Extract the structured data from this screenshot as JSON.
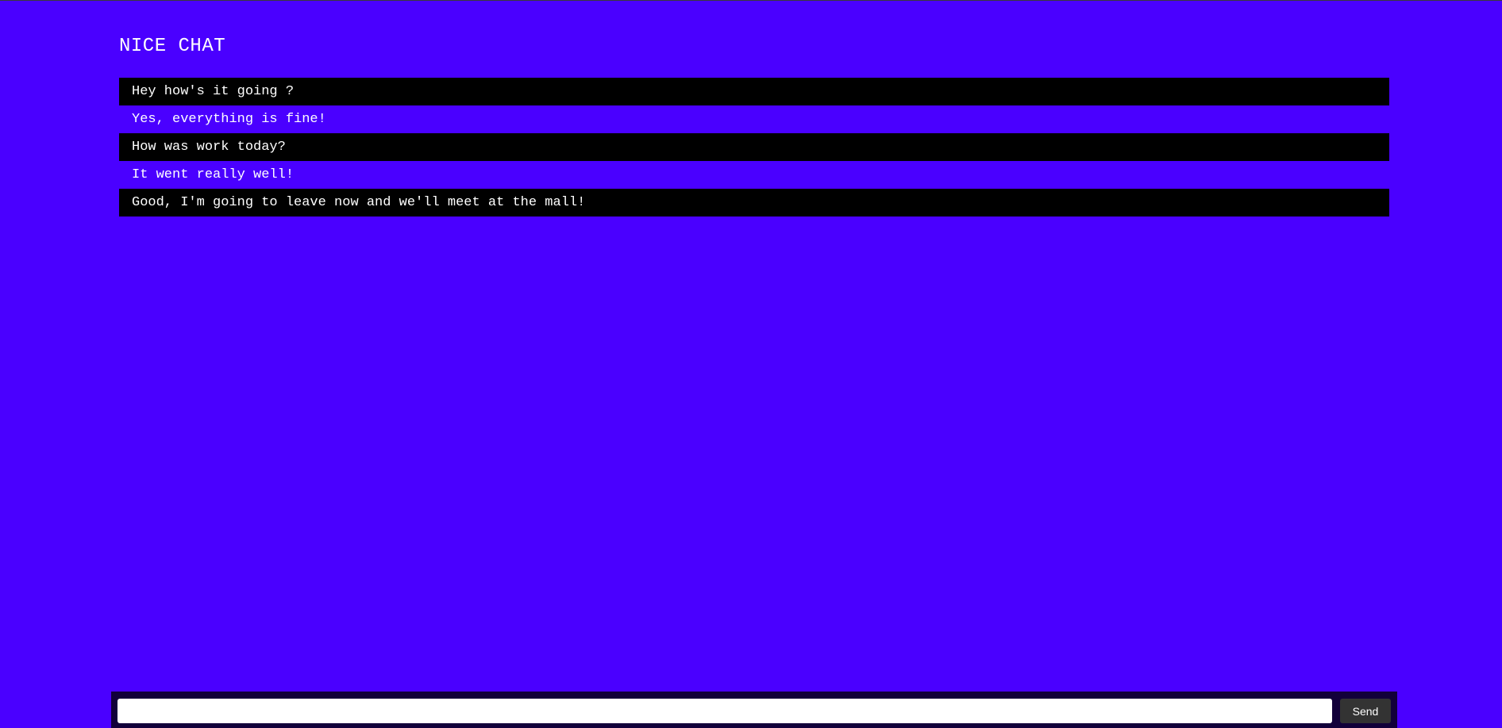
{
  "app": {
    "title": "NICE CHAT"
  },
  "messages": [
    {
      "text": "Hey how's it going ?",
      "style": "dark"
    },
    {
      "text": "Yes, everything is fine!",
      "style": "light"
    },
    {
      "text": "How was work today?",
      "style": "dark"
    },
    {
      "text": "It went really well!",
      "style": "light"
    },
    {
      "text": "Good, I'm going to leave now and we'll meet at the mall!",
      "style": "dark"
    }
  ],
  "compose": {
    "input_value": "",
    "input_placeholder": "",
    "send_label": "Send"
  },
  "colors": {
    "background": "#4a00ff",
    "message_dark": "#000000",
    "compose_bar": "#12003a",
    "send_button": "#333333",
    "text": "#ffffff"
  }
}
